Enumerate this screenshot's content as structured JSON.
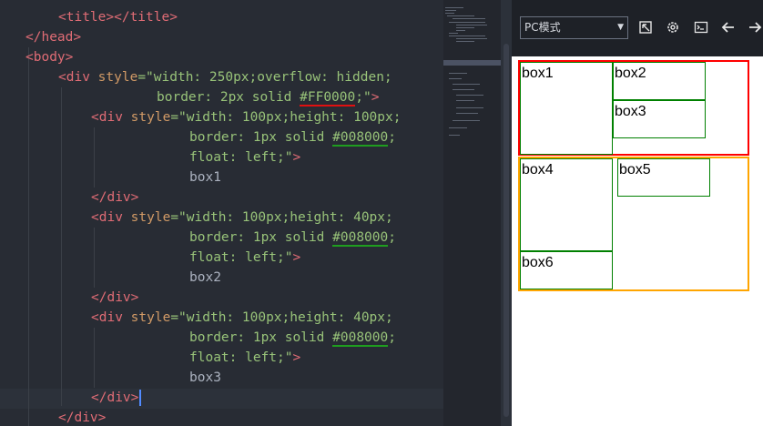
{
  "editor": {
    "lines": [
      {
        "parts": [
          {
            "t": "<title></title>",
            "c": "tag"
          }
        ]
      },
      {
        "parts": [
          {
            "t": "</head>",
            "c": "tag"
          }
        ]
      },
      {
        "parts": [
          {
            "t": "<body>",
            "c": "tag"
          }
        ]
      },
      {
        "parts": [
          {
            "t": "<div ",
            "c": "tag"
          },
          {
            "t": "style",
            "c": "attr"
          },
          {
            "t": "=\"width: 250px;overflow: hidden;",
            "c": "str"
          }
        ]
      },
      {
        "parts": [
          {
            "t": "border: 2px solid ",
            "c": "str"
          },
          {
            "t": "#FF0000",
            "c": "str",
            "u": "red"
          },
          {
            "t": ";\"",
            "c": "str"
          },
          {
            "t": ">",
            "c": "tag"
          }
        ]
      },
      {
        "parts": [
          {
            "t": "<div ",
            "c": "tag"
          },
          {
            "t": "style",
            "c": "attr"
          },
          {
            "t": "=\"width: 100px;height: 100px;",
            "c": "str"
          }
        ]
      },
      {
        "parts": [
          {
            "t": "border: 1px solid ",
            "c": "str"
          },
          {
            "t": "#008000",
            "c": "str",
            "u": "green"
          },
          {
            "t": ";",
            "c": "str"
          }
        ]
      },
      {
        "parts": [
          {
            "t": "float: left;\"",
            "c": "str"
          },
          {
            "t": ">",
            "c": "tag"
          }
        ]
      },
      {
        "parts": [
          {
            "t": "box1",
            "c": "txt"
          }
        ]
      },
      {
        "parts": [
          {
            "t": "</div>",
            "c": "tag"
          }
        ]
      },
      {
        "parts": [
          {
            "t": "<div ",
            "c": "tag"
          },
          {
            "t": "style",
            "c": "attr"
          },
          {
            "t": "=\"width: 100px;height: 40px;",
            "c": "str"
          }
        ]
      },
      {
        "parts": [
          {
            "t": "border: 1px solid ",
            "c": "str"
          },
          {
            "t": "#008000",
            "c": "str",
            "u": "green"
          },
          {
            "t": ";",
            "c": "str"
          }
        ]
      },
      {
        "parts": [
          {
            "t": "float: left;\"",
            "c": "str"
          },
          {
            "t": ">",
            "c": "tag"
          }
        ]
      },
      {
        "parts": [
          {
            "t": "box2",
            "c": "txt"
          }
        ]
      },
      {
        "parts": [
          {
            "t": "</div>",
            "c": "tag"
          }
        ]
      },
      {
        "parts": [
          {
            "t": "<div ",
            "c": "tag"
          },
          {
            "t": "style",
            "c": "attr"
          },
          {
            "t": "=\"width: 100px;height: 40px;",
            "c": "str"
          }
        ]
      },
      {
        "parts": [
          {
            "t": "border: 1px solid ",
            "c": "str"
          },
          {
            "t": "#008000",
            "c": "str",
            "u": "green"
          },
          {
            "t": ";",
            "c": "str"
          }
        ]
      },
      {
        "parts": [
          {
            "t": "float: left;\"",
            "c": "str"
          },
          {
            "t": ">",
            "c": "tag"
          }
        ]
      },
      {
        "parts": [
          {
            "t": "box3",
            "c": "txt"
          }
        ]
      },
      {
        "parts": [
          {
            "t": "</div>",
            "c": "tag"
          }
        ]
      },
      {
        "parts": [
          {
            "t": "</div>",
            "c": "tag"
          }
        ]
      }
    ]
  },
  "toolbar": {
    "mode_label": "PC模式",
    "open_icon": "external-open-icon",
    "settings_icon": "gear-icon",
    "console_icon": "terminal-icon",
    "back_icon": "arrow-left-icon",
    "forward_icon": "arrow-right-icon"
  },
  "preview": {
    "box1": "box1",
    "box2": "box2",
    "box3": "box3",
    "box4": "box4",
    "box5": "box5",
    "box6": "box6"
  },
  "colors": {
    "red_border": "#ff0000",
    "green_border": "#008000",
    "orange_border": "#ffa500"
  }
}
